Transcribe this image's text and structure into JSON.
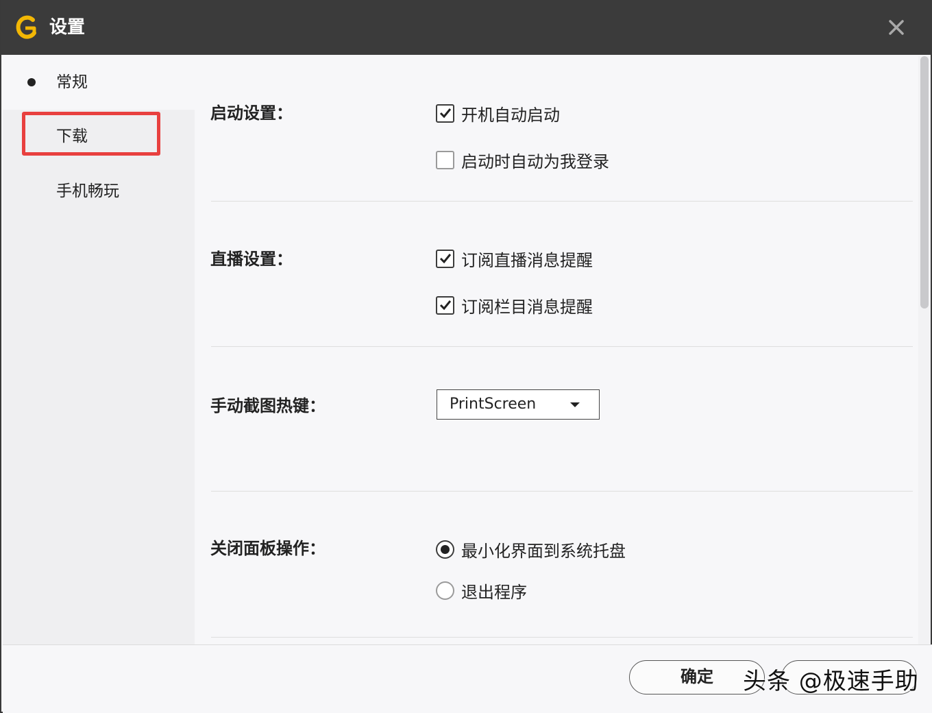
{
  "window": {
    "title": "设置",
    "icons": {
      "logo": "app-g-logo-icon",
      "close": "close-icon"
    }
  },
  "sidebar": {
    "items": [
      {
        "label": "常规",
        "bullet": true
      },
      {
        "label": "下载",
        "highlighted": true
      },
      {
        "label": "手机畅玩"
      }
    ]
  },
  "sections": {
    "startup": {
      "label": "启动设置：",
      "options": [
        {
          "label": "开机自动启动",
          "checked": true
        },
        {
          "label": "启动时自动为我登录",
          "checked": false
        }
      ]
    },
    "live": {
      "label": "直播设置：",
      "options": [
        {
          "label": "订阅直播消息提醒",
          "checked": true
        },
        {
          "label": "订阅栏目消息提醒",
          "checked": true
        }
      ]
    },
    "screenshot": {
      "label": "手动截图热键：",
      "hotkey_value": "PrintScreen"
    },
    "close_panel": {
      "label": "关闭面板操作：",
      "options": [
        {
          "label": "最小化界面到系统托盘",
          "selected": true
        },
        {
          "label": "退出程序",
          "selected": false
        }
      ]
    }
  },
  "footer": {
    "ok_label": "确定",
    "cancel_label": ""
  },
  "watermark": "头条 @极速手助",
  "colors": {
    "titlebar": "#3b3b3b",
    "highlight": "#e8403f",
    "logo": "#f2b705"
  }
}
